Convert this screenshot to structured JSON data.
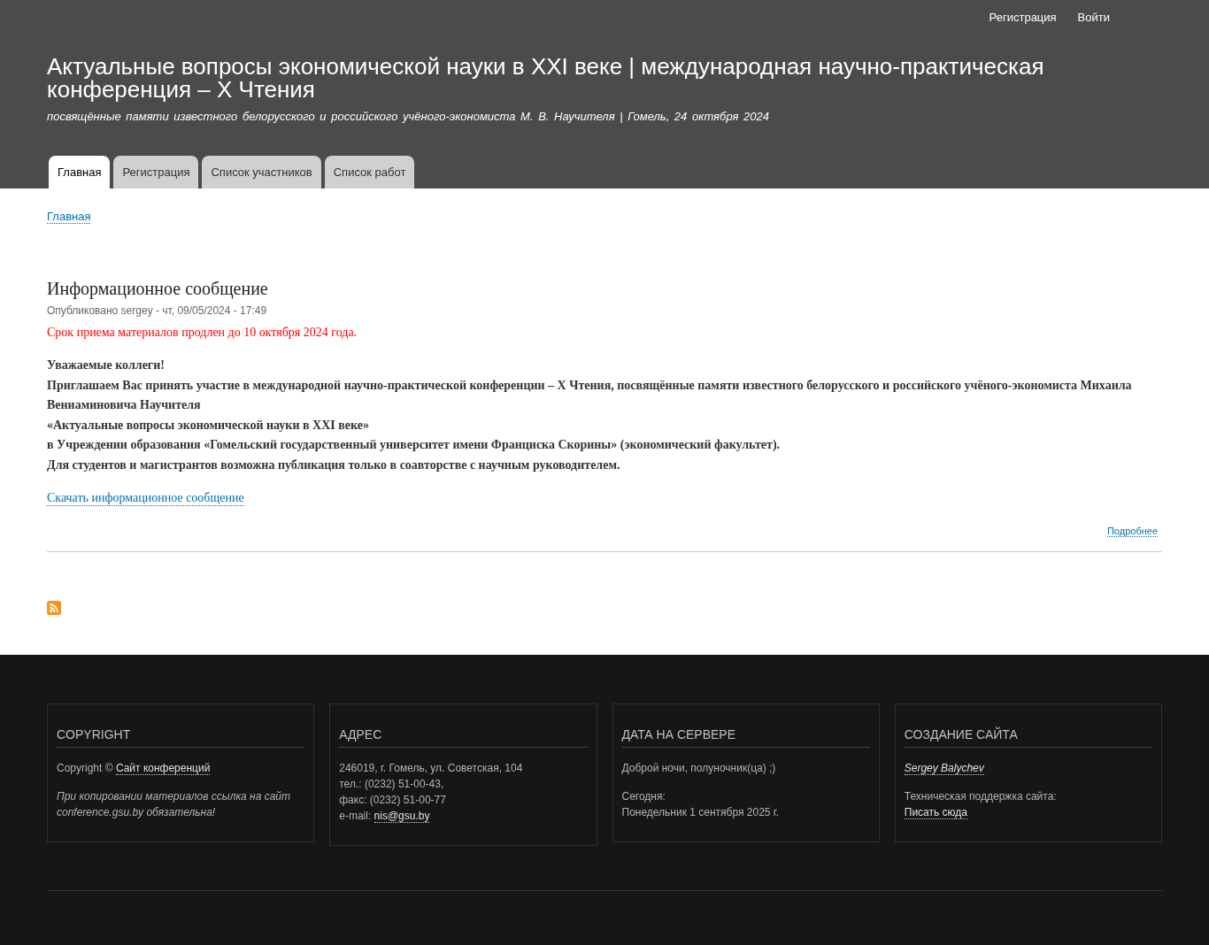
{
  "top_links": [
    "Регистрация",
    "Войти"
  ],
  "site_name": "Актуальные вопросы экономической науки в XXI веке | международная научно-практическая конференция – X Чтения",
  "slogan": "посвящённые памяти известного белорусского и российского учёного-экономиста М. В. Научителя | Гомель, 24 октября 2024",
  "tabs": [
    {
      "label": "Главная",
      "selected": true
    },
    {
      "label": "Регистрация",
      "selected": false
    },
    {
      "label": "Список участников",
      "selected": false
    },
    {
      "label": "Список работ",
      "selected": false
    }
  ],
  "breadcrumb": "Главная",
  "article": {
    "title": "Информационное сообщение",
    "meta": "Опубликовано sergey - чт, 09/05/2024 - 17:49",
    "notice": "Срок приема материалов продлен до 10 октября 2024 года.",
    "lines": [
      "Уважаемые коллеги!",
      "Приглашаем Вас принять участие в международной научно-практической конференции – X Чтения, посвящённые памяти известного белорусского и российского учёного-экономиста Михаила Вениаминовича Научителя",
      "«Актуальные вопросы экономической науки в XXI веке»",
      "в Учреждении образования «Гомельский государственный университет имени Франциска Скорины» (экономический факультет).",
      "Для студентов и магистрантов возможна публикация только в соавторстве с научным руководителем."
    ],
    "download_link": "Скачать информационное сообщение",
    "more_link": "Подробнее"
  },
  "footer_blocks": [
    {
      "title": "COPYRIGHT",
      "groups": [
        [
          {
            "italic": false,
            "parts": [
              {
                "text": "Copyright © ",
                "kind": "text"
              },
              {
                "text": "Сайт конференций",
                "kind": "link"
              }
            ]
          }
        ],
        [
          {
            "italic": true,
            "parts": [
              {
                "text": "При копировании материалов ссылка на сайт conference.gsu.by обязательна!",
                "kind": "text"
              }
            ]
          }
        ]
      ]
    },
    {
      "title": "АДРЕС",
      "groups": [
        [
          {
            "italic": false,
            "parts": [
              {
                "text": "246019, г. Гомель, ул. Советская, 104",
                "kind": "text"
              }
            ]
          },
          {
            "italic": false,
            "parts": [
              {
                "text": "тел.: (0232) 51-00-43,",
                "kind": "text"
              }
            ]
          },
          {
            "italic": false,
            "parts": [
              {
                "text": "факс: (0232) 51-00-77",
                "kind": "text"
              }
            ]
          },
          {
            "italic": false,
            "parts": [
              {
                "text": "e-mail: ",
                "kind": "text"
              },
              {
                "text": "nis@gsu.by",
                "kind": "link"
              }
            ]
          }
        ]
      ]
    },
    {
      "title": "ДАТА НА СЕРВЕРЕ",
      "groups": [
        [
          {
            "italic": false,
            "parts": [
              {
                "text": "Доброй ночи, полуночник(ца) ;)",
                "kind": "text"
              }
            ]
          }
        ],
        [
          {
            "italic": false,
            "parts": [
              {
                "text": "Сегодня:",
                "kind": "text"
              }
            ]
          },
          {
            "italic": false,
            "parts": [
              {
                "text": "Понедельник 1 сентября 2025 г.",
                "kind": "text"
              }
            ]
          }
        ]
      ]
    },
    {
      "title": "СОЗДАНИЕ САЙТА",
      "groups": [
        [
          {
            "italic": true,
            "parts": [
              {
                "text": "Sergey Balychev",
                "kind": "link"
              }
            ]
          }
        ],
        [
          {
            "italic": false,
            "parts": [
              {
                "text": "Техническая поддержка сайта:",
                "kind": "text"
              }
            ]
          },
          {
            "italic": false,
            "parts": [
              {
                "text": "Писать сюда",
                "kind": "link"
              }
            ]
          }
        ]
      ]
    }
  ]
}
